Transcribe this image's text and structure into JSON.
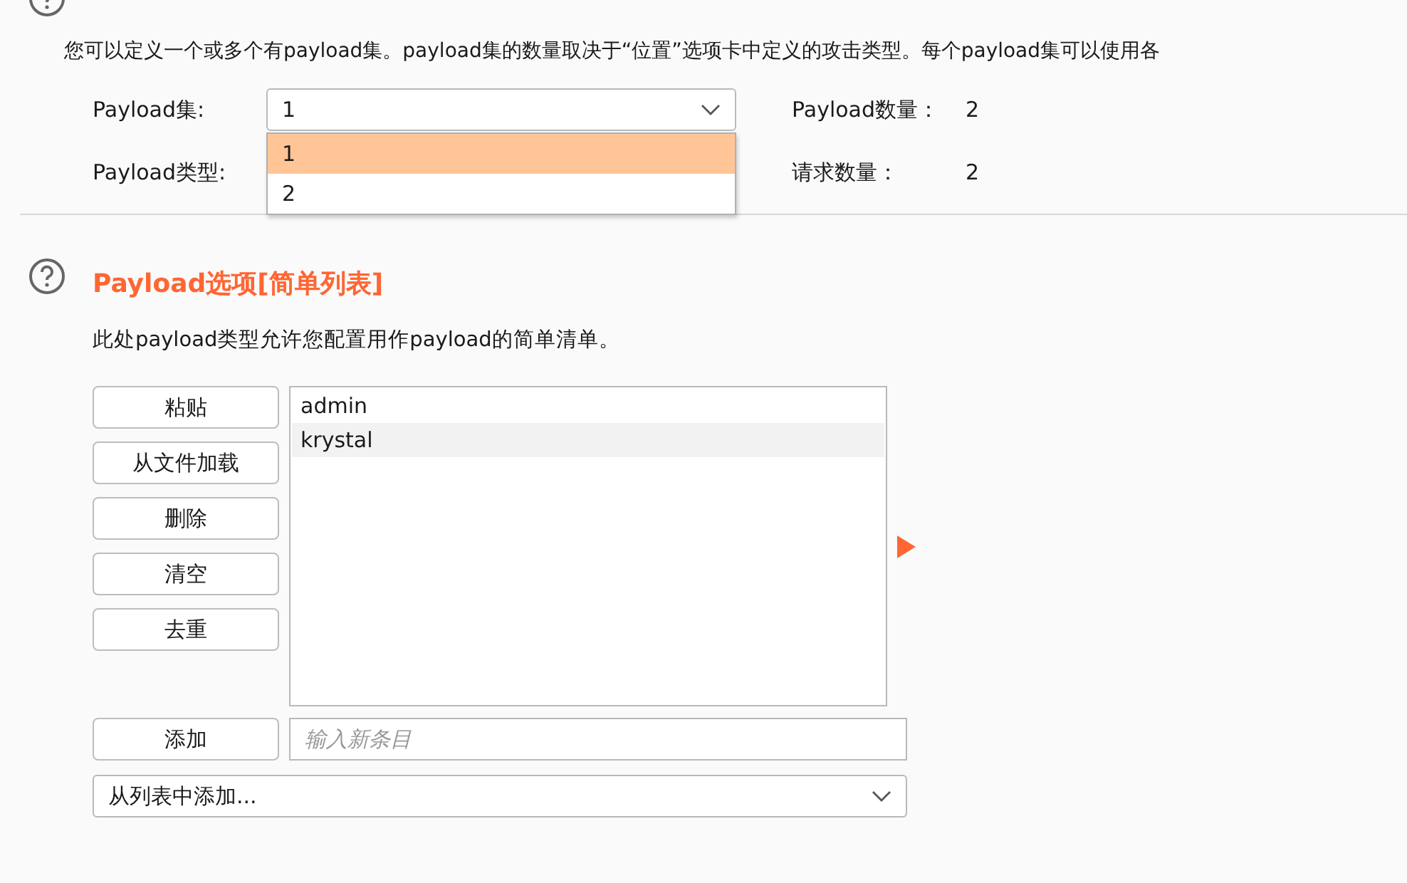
{
  "payload_sets_section": {
    "description": "您可以定义一个或多个有payload集。payload集的数量取决于“位置”选项卡中定义的攻击类型。每个payload集可以使用各",
    "fields": [
      {
        "label": "Payload集:",
        "value": "1",
        "open": true,
        "options": [
          {
            "label": "1",
            "selected": true
          },
          {
            "label": "2",
            "selected": false
          }
        ]
      },
      {
        "label": "Payload类型:",
        "open": false
      }
    ],
    "stats": [
      {
        "label": "Payload数量：",
        "value": "2"
      },
      {
        "label": "请求数量：",
        "value": "2"
      }
    ]
  },
  "payload_options_section": {
    "title": "Payload选项[简单列表]",
    "description": "此处payload类型允许您配置用作payload的简单清单。",
    "buttons": [
      "粘贴",
      "从文件加载",
      "删除",
      "清空",
      "去重"
    ],
    "list_items": [
      {
        "text": "admin",
        "selected": false
      },
      {
        "text": "krystal",
        "selected": true
      }
    ],
    "add_button": "添加",
    "new_item": {
      "placeholder": "输入新条目"
    },
    "add_from_list": {
      "value": "从列表中添加..."
    }
  }
}
